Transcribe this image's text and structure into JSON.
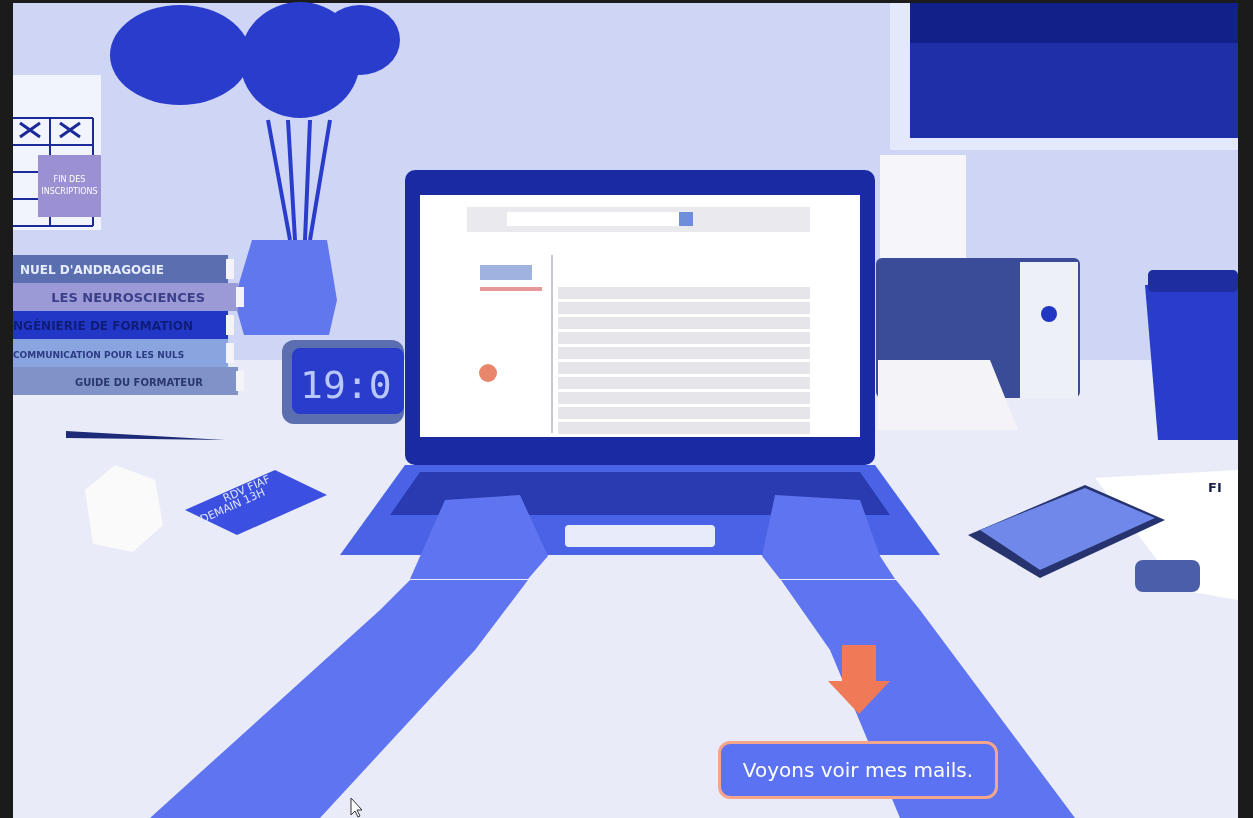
{
  "calendar_note": {
    "lines": [
      "FIN DES",
      "INSCRIPTIONS"
    ]
  },
  "books": [
    {
      "title": "NUEL D'ANDRAGOGIE"
    },
    {
      "title": "LES NEUROSCIENCES"
    },
    {
      "title": "NGÉNIERIE DE FORMATION"
    },
    {
      "title": "COMMUNICATION POUR LES NULS"
    },
    {
      "title": "GUIDE DU FORMATEUR"
    }
  ],
  "clock": {
    "time": "19:0"
  },
  "sticky_note": {
    "lines": [
      "RDV FIAF",
      "DEMAIN 13H"
    ]
  },
  "document": {
    "logo_text": "FI"
  },
  "callout": {
    "text": "Voyons voir mes mails."
  }
}
